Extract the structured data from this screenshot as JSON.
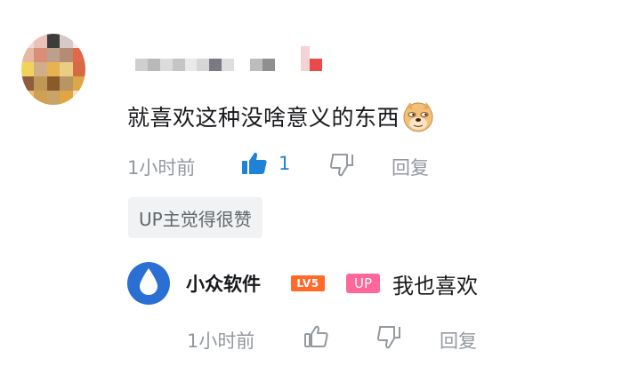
{
  "comment": {
    "text": "就喜欢这种没啥意义的东西",
    "time": "1小时前",
    "like_count": "1",
    "reply_label": "回复",
    "up_liked_tag": "UP主觉得很赞"
  },
  "reply": {
    "author": "小众软件",
    "level_badge": "LV5",
    "up_badge": "UP",
    "text": "我也喜欢",
    "time": "1小时前",
    "reply_label": "回复"
  },
  "colors": {
    "like_active": "#1f82d6",
    "meta_gray": "#9499a0",
    "up_pink": "#ff6699",
    "level_orange": "#ff6a2a",
    "avatar_blue": "#2a6fd3"
  },
  "icons": {
    "emoji": "doge-emoji-icon",
    "like": "thumbs-up-icon",
    "dislike": "thumbs-down-icon",
    "reply_avatar": "water-drop-icon"
  }
}
